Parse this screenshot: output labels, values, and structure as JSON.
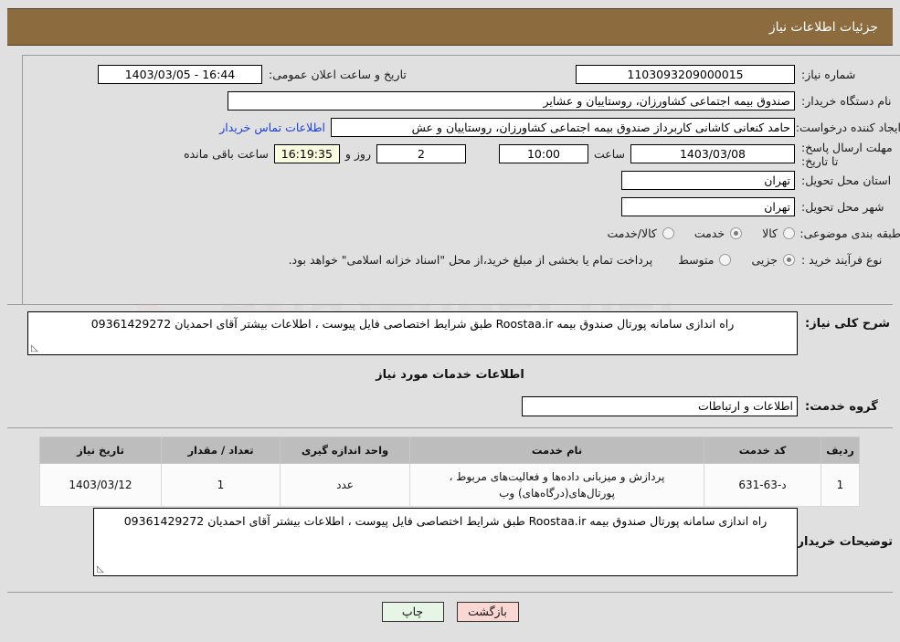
{
  "header": {
    "title": "جزئیات اطلاعات نیاز"
  },
  "form": {
    "need_number_label": "شماره نیاز:",
    "need_number_value": "1103093209000015",
    "announce_datetime_label": "تاریخ و ساعت اعلان عمومی:",
    "announce_datetime_value": "16:44 - 1403/03/05",
    "buyer_org_label": "نام دستگاه خریدار:",
    "buyer_org_value": "صندوق بیمه اجتماعی کشاورزان، روستاییان و عشایر",
    "creator_label": "ایجاد کننده درخواست:",
    "creator_value": "حامد کنعانی کاشانی کاربرداز صندوق بیمه اجتماعی کشاورزان، روستاییان و عش",
    "contact_link": "اطلاعات تماس خریدار",
    "deadline_label": "مهلت ارسال پاسخ: تا تاریخ:",
    "deadline_date": "1403/03/08",
    "time_label": "ساعت",
    "deadline_time": "10:00",
    "days_remaining": "2",
    "days_label": "روز و",
    "timer_value": "16:19:35",
    "remaining_label": "ساعت باقی مانده",
    "province_label": "استان محل تحویل:",
    "province_value": "تهران",
    "city_label": "شهر محل تحویل:",
    "city_value": "تهران",
    "category_label": "طبقه بندی موضوعی:",
    "category_options": [
      {
        "label": "کالا",
        "selected": false
      },
      {
        "label": "خدمت",
        "selected": true
      },
      {
        "label": "کالا/خدمت",
        "selected": false
      }
    ],
    "process_label": "نوع فرآیند خرید :",
    "process_options": [
      {
        "label": "جزیی",
        "selected": true
      },
      {
        "label": "متوسط",
        "selected": false
      }
    ],
    "payment_note": "پرداخت تمام یا بخشی از مبلغ خرید،از محل \"اسناد خزانه اسلامی\" خواهد بود."
  },
  "description": {
    "label": "شرح کلی نیاز:",
    "value": "راه اندازی سامانه پورتال صندوق بیمه Roostaa.ir طبق شرایط اختصاصی فایل پیوست ، اطلاعات بیشتر آقای احمدیان 09361429272"
  },
  "services_section": {
    "title": "اطلاعات خدمات مورد نیاز",
    "group_label": "گروه خدمت:",
    "group_value": "اطلاعات و ارتباطات"
  },
  "table": {
    "columns": [
      "ردیف",
      "کد خدمت",
      "نام خدمت",
      "واحد اندازه گیری",
      "تعداد / مقدار",
      "تاریخ نیاز"
    ],
    "rows": [
      {
        "row_no": "1",
        "service_code": "د-63-631",
        "service_name": "پردازش و میزبانی داده‌ها و فعالیت‌های مربوط ، پورتال‌های(درگاه‌های) وب",
        "unit": "عدد",
        "quantity": "1",
        "need_date": "1403/03/12"
      }
    ]
  },
  "buyer_notes": {
    "label": "توضیحات خریدار:",
    "value": "راه اندازی سامانه پورتال صندوق بیمه Roostaa.ir طبق شرایط اختصاصی فایل پیوست ، اطلاعات بیشتر آقای احمدیان 09361429272"
  },
  "buttons": {
    "print": "چاپ",
    "back": "بازگشت"
  },
  "watermark": {
    "text": "AriaTender.net"
  },
  "colors": {
    "header_bg": "#8c6b3f",
    "header_text": "#ffffff",
    "link": "#1a3fd4",
    "timer_bg": "#fbfbe0",
    "table_header_bg": "#bdbdbd",
    "print_btn_bg": "#e6f5e6",
    "back_btn_bg": "#fbd7d4",
    "page_bg": "#e0e0e0"
  }
}
